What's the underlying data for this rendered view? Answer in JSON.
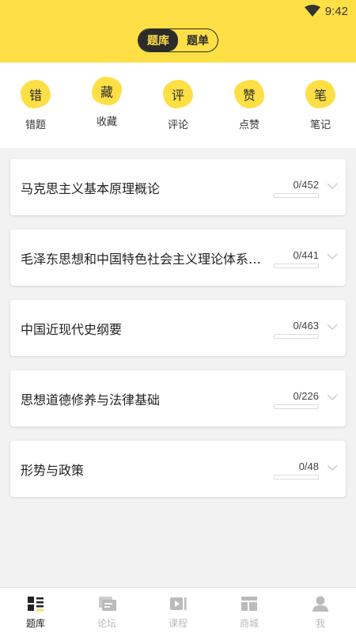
{
  "status_bar": {
    "time": "9:42"
  },
  "header": {
    "segments": [
      {
        "label": "题库",
        "active": true
      },
      {
        "label": "题单",
        "active": false
      }
    ]
  },
  "quick_actions": [
    {
      "glyph": "错",
      "label": "错题"
    },
    {
      "glyph": "藏",
      "label": "收藏"
    },
    {
      "glyph": "评",
      "label": "评论"
    },
    {
      "glyph": "赞",
      "label": "点赞"
    },
    {
      "glyph": "笔",
      "label": "笔记"
    }
  ],
  "courses": [
    {
      "title": "马克思主义基本原理概论",
      "count": "0/452",
      "progress": 0
    },
    {
      "title": "毛泽东思想和中国特色社会主义理论体系概论",
      "count": "0/441",
      "progress": 0
    },
    {
      "title": "中国近现代史纲要",
      "count": "0/463",
      "progress": 0
    },
    {
      "title": "思想道德修养与法律基础",
      "count": "0/226",
      "progress": 0
    },
    {
      "title": "形势与政策",
      "count": "0/48",
      "progress": 0
    }
  ],
  "bottom_nav": [
    {
      "label": "题库",
      "icon": "question-bank-icon",
      "active": true
    },
    {
      "label": "论坛",
      "icon": "forum-icon",
      "active": false
    },
    {
      "label": "课程",
      "icon": "course-video-icon",
      "active": false
    },
    {
      "label": "商城",
      "icon": "store-icon",
      "active": false
    },
    {
      "label": "我",
      "icon": "profile-icon",
      "active": false
    }
  ],
  "colors": {
    "accent": "#fedf45",
    "dark": "#2b2b2b",
    "inactive": "#bbbbbb"
  }
}
